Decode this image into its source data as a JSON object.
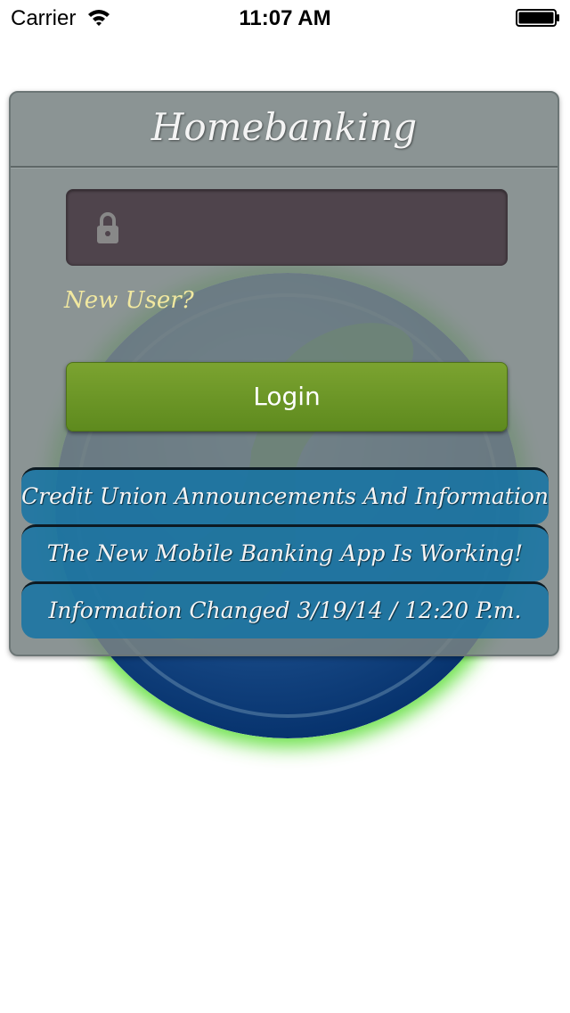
{
  "status_bar": {
    "carrier": "Carrier",
    "time": "11:07 AM"
  },
  "login_panel": {
    "title": "Homebanking",
    "password_placeholder": "",
    "new_user_label": "New User?",
    "login_label": "Login"
  },
  "announcements": [
    {
      "text": "Credit Union Announcements And Information"
    },
    {
      "text": "The New Mobile Banking App Is Working!"
    },
    {
      "text": "Information Changed 3/19/14 / 12:20 P.m."
    }
  ],
  "icons": {
    "wifi": "wifi-icon",
    "battery": "battery-icon",
    "lock": "lock-icon",
    "globe": "globe-icon"
  },
  "colors": {
    "panel_bg": "#788282",
    "login_button": "#6e9a28",
    "announcement_bg": "#1473a5",
    "new_user_text": "#f1e8a0",
    "globe_glow": "#50dc28"
  }
}
